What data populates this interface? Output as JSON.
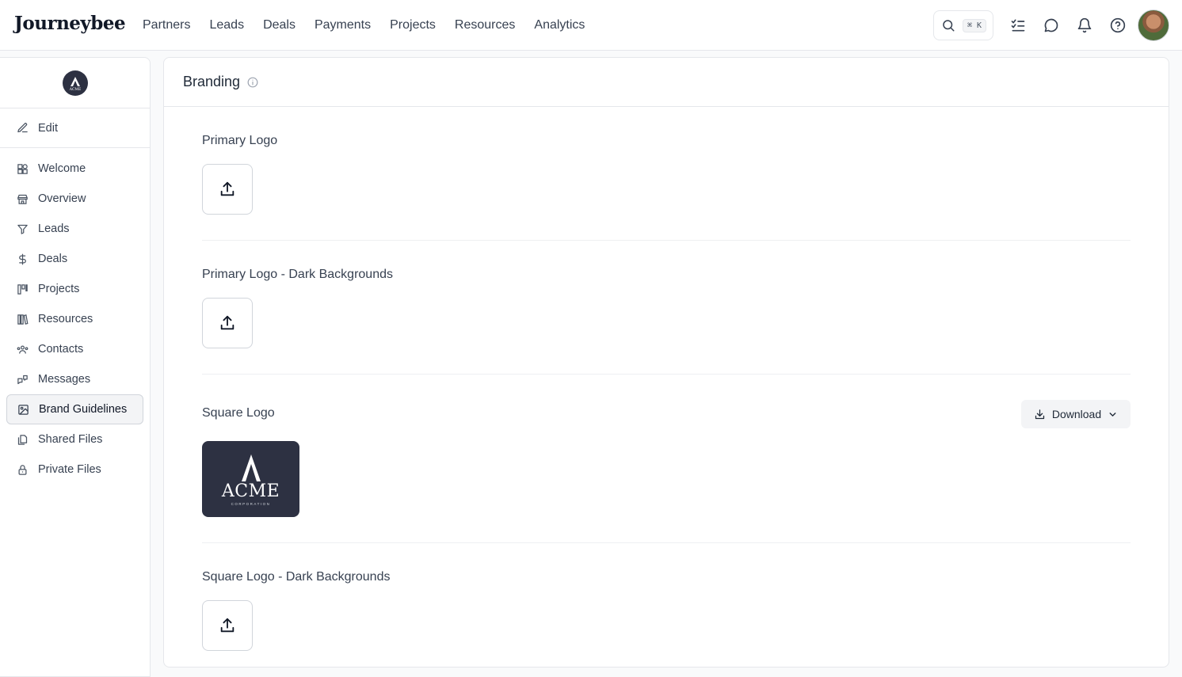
{
  "app": {
    "brand": "Journeybee"
  },
  "nav": [
    "Partners",
    "Leads",
    "Deals",
    "Payments",
    "Projects",
    "Resources",
    "Analytics"
  ],
  "search": {
    "shortcut": "⌘ K"
  },
  "sidebar": {
    "org_logo_text": "ACME",
    "edit_label": "Edit",
    "items": [
      {
        "label": "Welcome",
        "icon": "widgets-icon"
      },
      {
        "label": "Overview",
        "icon": "store-icon"
      },
      {
        "label": "Leads",
        "icon": "filter-icon"
      },
      {
        "label": "Deals",
        "icon": "dollar-icon"
      },
      {
        "label": "Projects",
        "icon": "kanban-icon"
      },
      {
        "label": "Resources",
        "icon": "library-icon"
      },
      {
        "label": "Contacts",
        "icon": "users-icon"
      },
      {
        "label": "Messages",
        "icon": "message-square-icon"
      },
      {
        "label": "Brand Guidelines",
        "icon": "image-icon",
        "active": true
      },
      {
        "label": "Shared Files",
        "icon": "files-icon"
      },
      {
        "label": "Private Files",
        "icon": "lock-icon"
      }
    ]
  },
  "main": {
    "title": "Branding",
    "sections": [
      {
        "title": "Primary Logo"
      },
      {
        "title": "Primary Logo - Dark Backgrounds"
      },
      {
        "title": "Square Logo",
        "download_label": "Download",
        "logo_word": "ACME",
        "logo_sub": "CORPORATION"
      },
      {
        "title": "Square Logo - Dark Backgrounds"
      }
    ]
  }
}
